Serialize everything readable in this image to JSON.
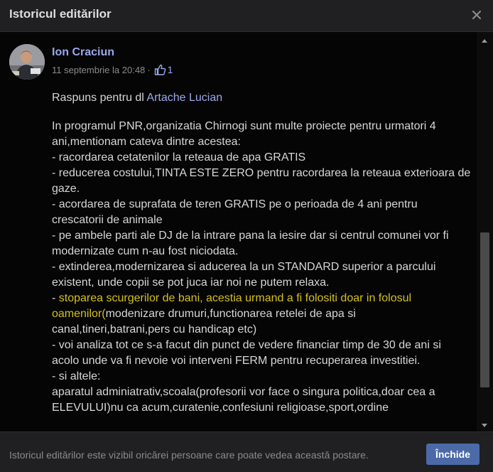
{
  "dialog": {
    "title": "Istoricul editărilor",
    "close_icon": "close-icon"
  },
  "post": {
    "author": "Ion Craciun",
    "date": "11 septembrie la 20:48",
    "separator": "·",
    "like_icon": "thumbs-up-icon",
    "like_count": "1",
    "reply_prefix": "Raspuns pentru dl ",
    "reply_to": "Artache Lucian",
    "paragraph_1": "In programul PNR,organizatia Chirnogi sunt multe proiecte pentru urmatori 4 ani,mentionam cateva dintre acestea:\n- racordarea cetatenilor la reteaua de apa GRATIS\n- reducerea costului,TINTA ESTE ZERO pentru racordarea la reteaua exterioara de gaze.\n- acordarea de suprafata de teren GRATIS pe o perioada de 4 ani pentru crescatorii de animale\n- pe ambele parti ale DJ de la intrare pana la iesire dar si centrul comunei vor fi modernizate cum n-au fost niciodata.\n- extinderea,modernizarea si aducerea la un STANDARD superior a parcului existent, unde copii se pot juca iar noi ne putem relaxa.\n- ",
    "highlight": "stoparea scurgerilor de bani, acestia urmand a fi folositi doar in folosul oamenilor(",
    "paragraph_2": "modenizare drumuri,functionarea retelei de apa si canal,tineri,batrani,pers cu handicap etc)\n- voi analiza tot ce s-a facut din punct de vedere financiar timp de 30 de ani si acolo unde va fi nevoie voi interveni FERM pentru recuperarea investitiei.\n- si altele:\naparatul adminiatrativ,scoala(profesorii vor face o singura politica,doar cea a ELEVULUI)nu ca acum,curatenie,confesiuni religioase,sport,ordine"
  },
  "footer": {
    "note": "Istoricul editărilor este vizibil oricărei persoane care poate vedea această postare.",
    "close_label": "Închide"
  },
  "colors": {
    "background": "#050505",
    "panel": "#202022",
    "link": "#9aa8e8",
    "highlight": "#d4c01a",
    "button": "#4c6aa8"
  }
}
